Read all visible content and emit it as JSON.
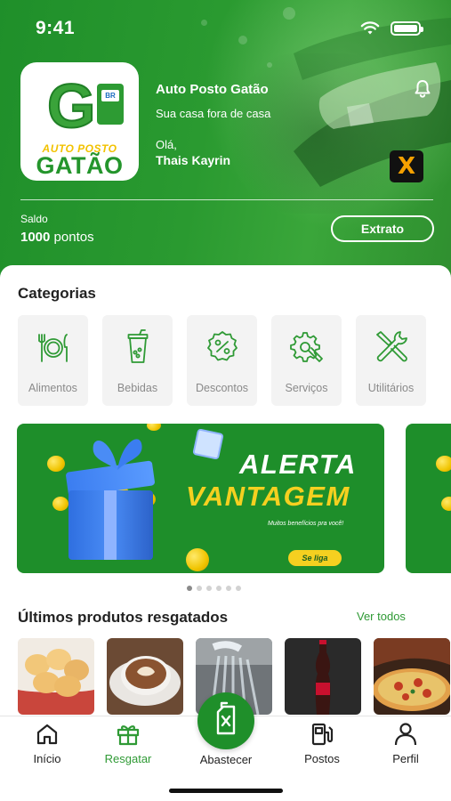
{
  "status": {
    "time": "9:41"
  },
  "store": {
    "name": "Auto Posto Gatão",
    "tagline": "Sua casa fora de casa",
    "logo_sub": "AUTO POSTO",
    "logo_name": "GATÃO",
    "logo_pump_text": "BR"
  },
  "user": {
    "greeting": "Olá,",
    "name": "Thais Kayrin"
  },
  "badge_letter": "X",
  "balance": {
    "label": "Saldo",
    "value": "1000",
    "unit": "pontos",
    "button": "Extrato"
  },
  "categories": {
    "title": "Categorias",
    "items": [
      {
        "label": "Alimentos",
        "icon": "utensils-icon"
      },
      {
        "label": "Bebidas",
        "icon": "drink-cup-icon"
      },
      {
        "label": "Descontos",
        "icon": "discount-badge-icon"
      },
      {
        "label": "Serviços",
        "icon": "gear-wrench-icon"
      },
      {
        "label": "Utilitários",
        "icon": "tools-icon"
      }
    ]
  },
  "banner": {
    "line1": "ALERTA",
    "line2": "VANTAGEM",
    "subtitle": "Muitos benefícios pra você!",
    "button": "Se liga"
  },
  "carousel": {
    "pages": 6,
    "active": 0
  },
  "products": {
    "title": "Últimos produtos resgatados",
    "see_all": "Ver todos",
    "items": [
      {
        "name": "pão de queijo"
      },
      {
        "name": "café"
      },
      {
        "name": "lavagem"
      },
      {
        "name": "coca-cola"
      },
      {
        "name": "pizza"
      }
    ]
  },
  "tabs": [
    {
      "label": "Início",
      "icon": "home-icon",
      "active": false
    },
    {
      "label": "Resgatar",
      "icon": "gift-icon",
      "active": true
    },
    {
      "label": "Abastecer",
      "icon": "fuel-can-icon",
      "active": false
    },
    {
      "label": "Postos",
      "icon": "gas-station-icon",
      "active": false
    },
    {
      "label": "Perfil",
      "icon": "user-icon",
      "active": false
    }
  ],
  "colors": {
    "primary": "#1f8f2a",
    "accent_yellow": "#f5d020",
    "link_green": "#2f9a35"
  }
}
